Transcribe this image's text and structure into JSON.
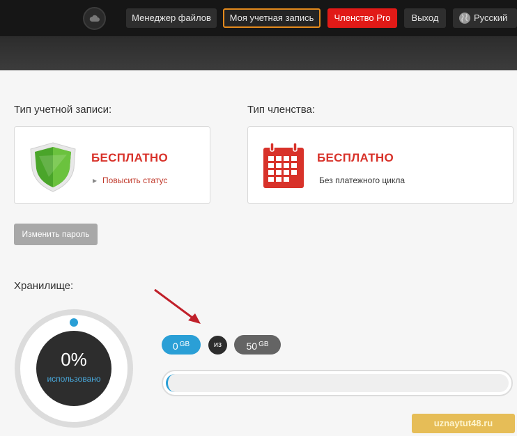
{
  "nav": {
    "file_manager": "Менеджер файлов",
    "my_account": "Моя учетная запись",
    "pro": "Членство Pro",
    "logout": "Выход",
    "language": "Русский"
  },
  "account_type": {
    "label": "Тип учетной записи:",
    "value": "БЕСПЛАТНО",
    "upgrade_link": "Повысить статус"
  },
  "membership_type": {
    "label": "Тип членства:",
    "value": "БЕСПЛАТНО",
    "billing": "Без платежного цикла"
  },
  "change_password": "Изменить пароль",
  "storage": {
    "label": "Хранилище:",
    "percent": "0%",
    "used_label": "использовано",
    "used": "0",
    "used_unit": "GB",
    "of": "из",
    "total": "50",
    "total_unit": "GB",
    "fraction_used": 0
  },
  "watermark": "uznaytut48.ru",
  "colors": {
    "accent_red": "#d8322a",
    "accent_blue": "#2a9fd6",
    "active_border": "#e48a1c"
  },
  "icons": [
    "cloud-logo-icon",
    "globe-icon",
    "shield-icon",
    "calendar-icon",
    "arrow-annotation"
  ]
}
